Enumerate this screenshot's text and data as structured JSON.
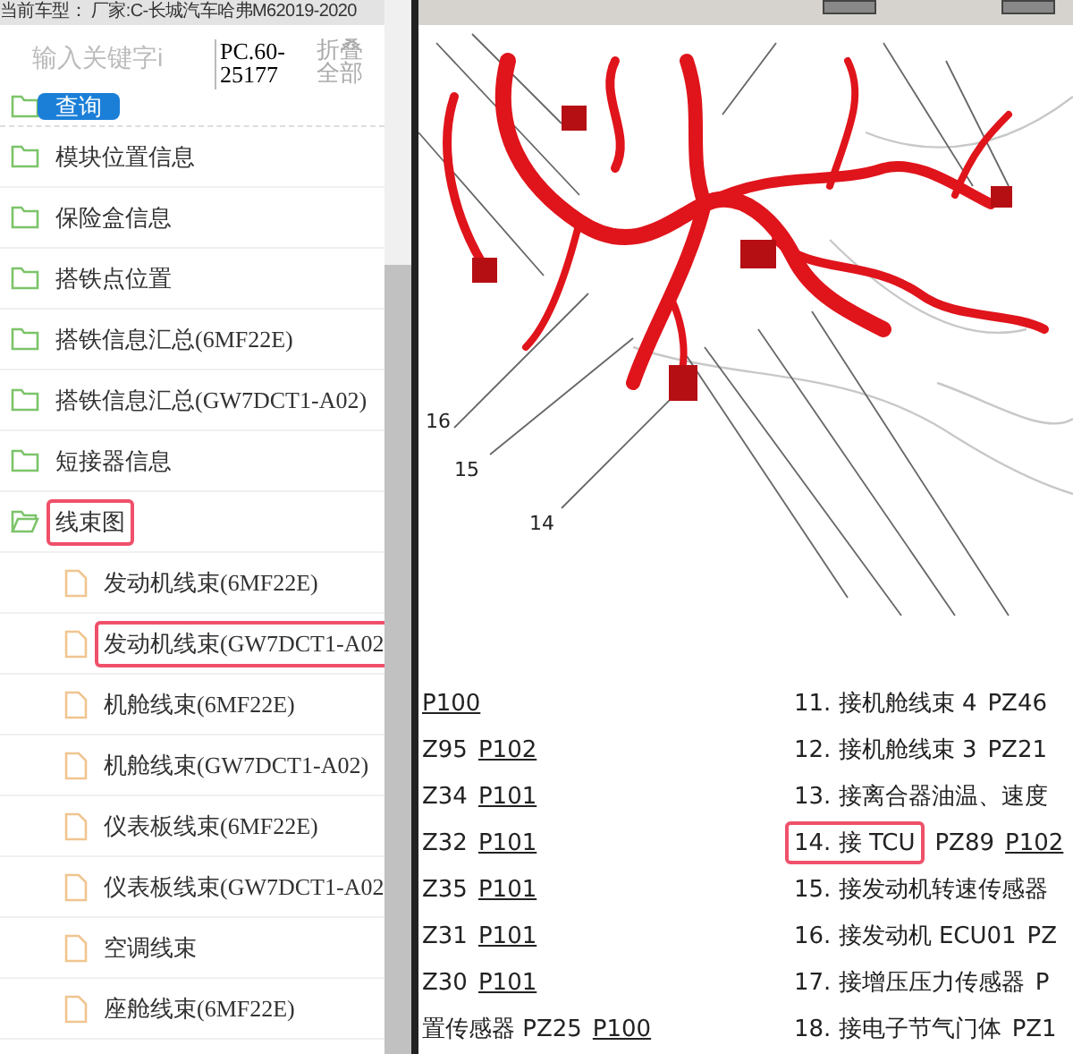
{
  "header": {
    "vehicle": "当前车型： 厂家:C-长城汽车哈弗M62019-2020"
  },
  "search": {
    "placeholder": "输入关键字i",
    "code": "PC.60-25177",
    "collapse_all": "折叠全部",
    "button": "查询"
  },
  "tree": [
    {
      "label": "模块位置信息",
      "expanded": false,
      "highlighted": false
    },
    {
      "label": "保险盒信息",
      "expanded": false,
      "highlighted": false
    },
    {
      "label": "搭铁点位置",
      "expanded": false,
      "highlighted": false
    },
    {
      "label": "搭铁信息汇总(6MF22E)",
      "expanded": false,
      "highlighted": false
    },
    {
      "label": "搭铁信息汇总(GW7DCT1-A02)",
      "expanded": false,
      "highlighted": false
    },
    {
      "label": "短接器信息",
      "expanded": false,
      "highlighted": false
    },
    {
      "label": "线束图",
      "expanded": true,
      "highlighted": true,
      "children": [
        {
          "label": "发动机线束(6MF22E)",
          "highlighted": false
        },
        {
          "label": "发动机线束(GW7DCT1-A02",
          "highlighted": true
        },
        {
          "label": "机舱线束(6MF22E)",
          "highlighted": false
        },
        {
          "label": "机舱线束(GW7DCT1-A02)",
          "highlighted": false
        },
        {
          "label": "仪表板线束(6MF22E)",
          "highlighted": false
        },
        {
          "label": "仪表板线束(GW7DCT1-A02",
          "highlighted": false
        },
        {
          "label": "空调线束",
          "highlighted": false
        },
        {
          "label": "座舱线束(6MF22E)",
          "highlighted": false
        }
      ]
    }
  ],
  "diagram": {
    "callouts": [
      "16",
      "15",
      "14"
    ]
  },
  "legend": {
    "left": [
      {
        "link": "P100"
      },
      {
        "text": "Z95",
        "link": "P102"
      },
      {
        "text": "Z34",
        "link": "P101"
      },
      {
        "text": "Z32",
        "link": "P101"
      },
      {
        "text": "Z35",
        "link": "P101"
      },
      {
        "text": "Z31",
        "link": "P101"
      },
      {
        "text": "Z30",
        "link": "P101"
      },
      {
        "text": "置传感器 PZ25",
        "link": "P100"
      }
    ],
    "right": [
      {
        "label": "11. 接机舱线束 4",
        "code": "PZ46",
        "highlighted": false
      },
      {
        "label": "12. 接机舱线束 3",
        "code": "PZ21",
        "highlighted": false
      },
      {
        "label": "13. 接离合器油温、速度",
        "highlighted": false
      },
      {
        "label": "14. 接 TCU",
        "code": "PZ89",
        "link": "P102",
        "highlighted": true
      },
      {
        "label": "15. 接发动机转速传感器",
        "highlighted": false
      },
      {
        "label": "16. 接发动机 ECU01",
        "code": "PZ",
        "highlighted": false
      },
      {
        "label": "17. 接增压压力传感器",
        "code": "P",
        "highlighted": false
      },
      {
        "label": "18. 接电子节气门体",
        "code": "PZ1",
        "highlighted": false
      }
    ]
  }
}
